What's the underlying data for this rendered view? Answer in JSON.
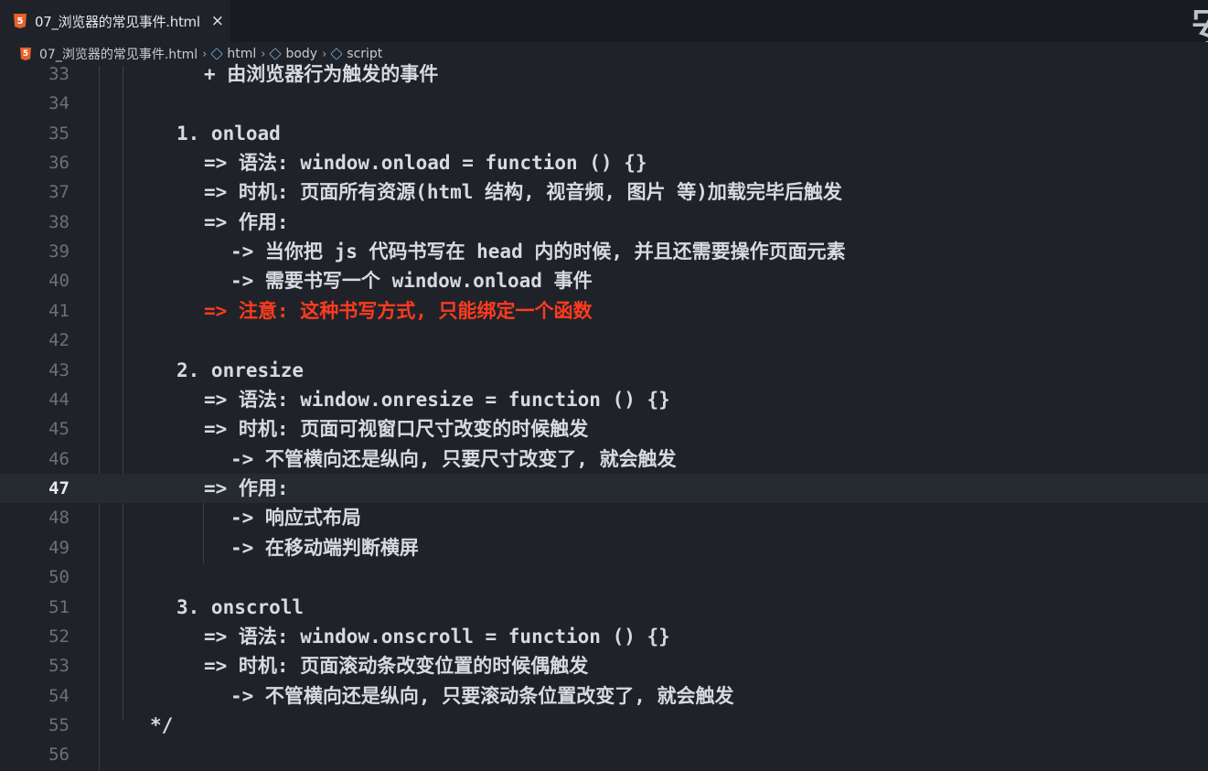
{
  "tab": {
    "title": "07_浏览器的常见事件.html",
    "close_label": "×",
    "icon": "html5-icon",
    "icon_text": "5"
  },
  "breadcrumb": {
    "file": "07_浏览器的常见事件.html",
    "items": [
      "html",
      "body",
      "script"
    ],
    "separator": "›"
  },
  "corner_glyph": "安",
  "editor": {
    "current_line": 47,
    "accent_color": "#ff3b1f",
    "lines": [
      {
        "n": "33",
        "text": "+ 由浏览器行为触发的事件"
      },
      {
        "n": "34",
        "text": ""
      },
      {
        "n": "35",
        "text": "1. onload"
      },
      {
        "n": "36",
        "text": "=> 语法: window.onload = function () {}"
      },
      {
        "n": "37",
        "text": "=> 时机: 页面所有资源(html 结构, 视音频, 图片 等)加载完毕后触发"
      },
      {
        "n": "38",
        "text": "=> 作用:"
      },
      {
        "n": "39",
        "text": "-> 当你把 js 代码书写在 head 内的时候, 并且还需要操作页面元素"
      },
      {
        "n": "40",
        "text": "-> 需要书写一个 window.onload 事件"
      },
      {
        "n": "41",
        "text": "=> 注意: 这种书写方式, 只能绑定一个函数"
      },
      {
        "n": "42",
        "text": ""
      },
      {
        "n": "43",
        "text": "2. onresize"
      },
      {
        "n": "44",
        "text": "=> 语法: window.onresize = function () {}"
      },
      {
        "n": "45",
        "text": "=> 时机: 页面可视窗口尺寸改变的时候触发"
      },
      {
        "n": "46",
        "text": "-> 不管横向还是纵向, 只要尺寸改变了, 就会触发"
      },
      {
        "n": "47",
        "text": "=> 作用:"
      },
      {
        "n": "48",
        "text": "-> 响应式布局"
      },
      {
        "n": "49",
        "text": "-> 在移动端判断横屏"
      },
      {
        "n": "50",
        "text": ""
      },
      {
        "n": "51",
        "text": "3. onscroll"
      },
      {
        "n": "52",
        "text": "=> 语法: window.onscroll = function () {}"
      },
      {
        "n": "53",
        "text": "=> 时机: 页面滚动条改变位置的时候偶触发"
      },
      {
        "n": "54",
        "text": "-> 不管横向还是纵向, 只要滚动条位置改变了, 就会触发"
      },
      {
        "n": "55",
        "text": "*/"
      },
      {
        "n": "56",
        "text": ""
      }
    ]
  }
}
